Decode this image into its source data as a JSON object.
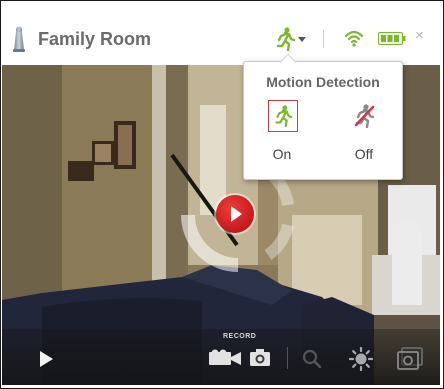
{
  "header": {
    "title": "Family Room",
    "camera_icon": "camera-icon",
    "motion_icon": "motion-running-icon",
    "wifi_icon": "wifi-icon",
    "battery_icon": "battery-icon",
    "close_label": "×"
  },
  "motion_menu": {
    "title": "Motion Detection",
    "options": [
      {
        "label": "On",
        "icon": "motion-on-icon",
        "selected": true
      },
      {
        "label": "Off",
        "icon": "motion-off-icon",
        "selected": false
      }
    ]
  },
  "controls": {
    "record_label": "RECORD",
    "play_icon": "play-icon",
    "video_icon": "video-camera-icon",
    "photo_icon": "photo-camera-icon",
    "zoom_icon": "zoom-icon",
    "brightness_icon": "brightness-icon",
    "snapshots_icon": "snapshots-icon"
  },
  "colors": {
    "accent_green": "#7cb82f",
    "record_red": "#d42a2a",
    "selection_border": "#d23b3b"
  }
}
